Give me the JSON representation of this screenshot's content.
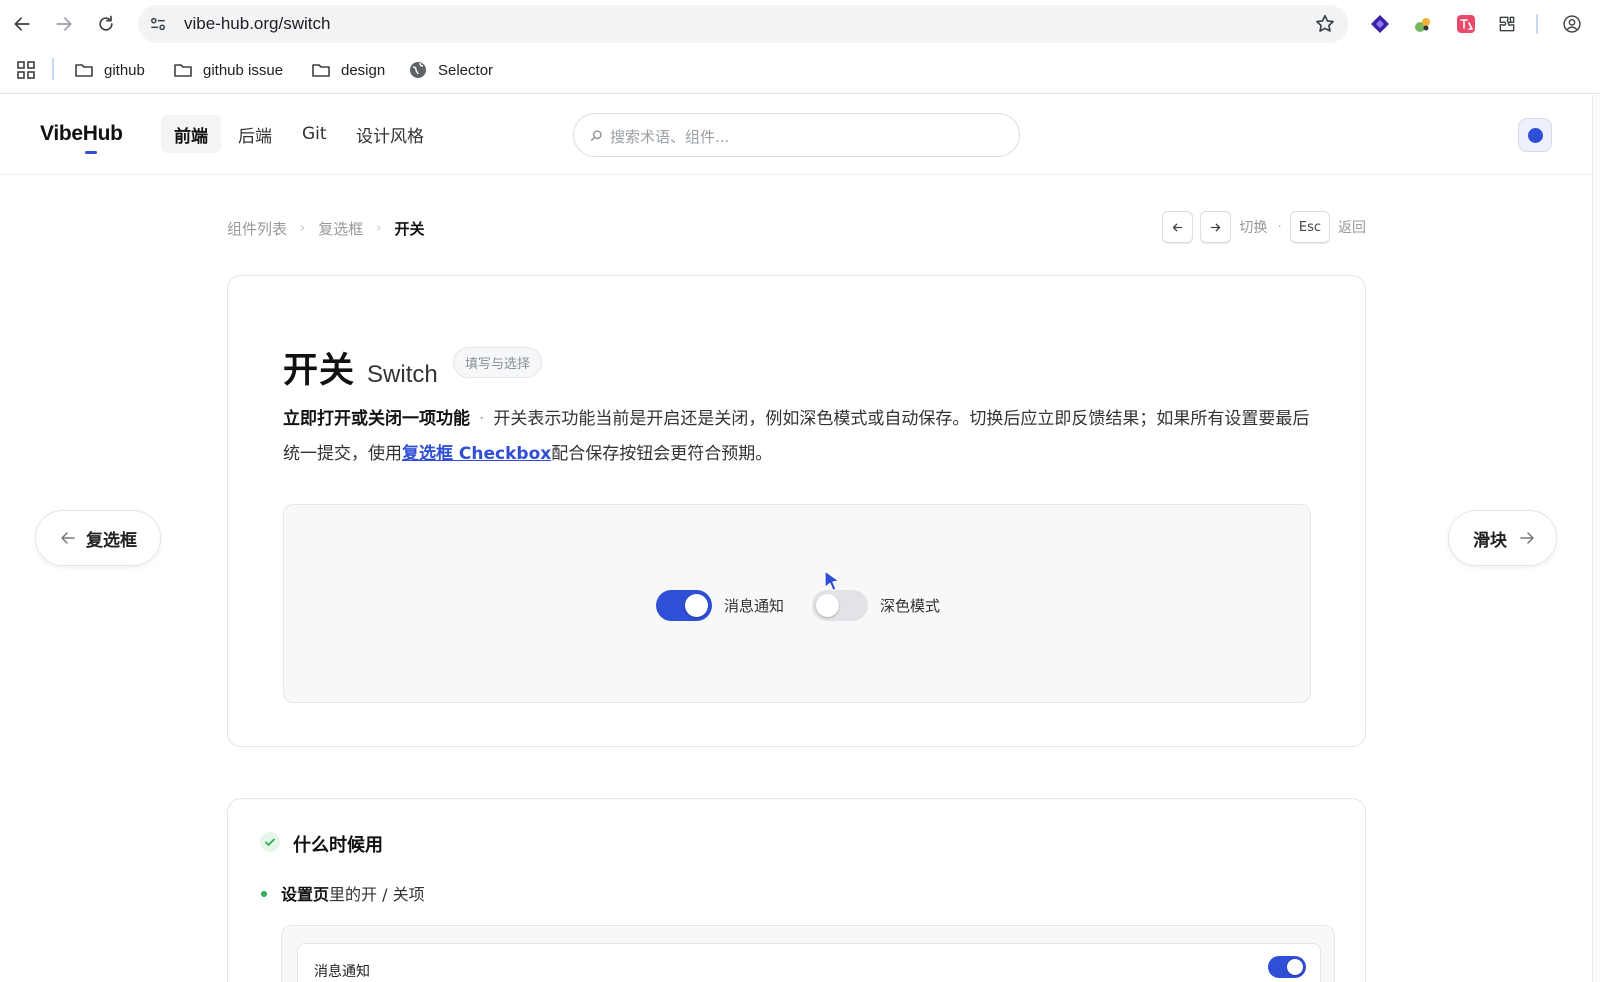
{
  "browser": {
    "url": "vibe-hub.org/switch",
    "bookmarks": [
      "github",
      "github issue",
      "design",
      "Selector"
    ]
  },
  "header": {
    "logo": "VibeHub",
    "tabs": [
      "前端",
      "后端",
      "Git",
      "设计风格"
    ],
    "active_tab": "前端",
    "search_placeholder": "搜索术语、组件...",
    "accent_color": "#2f4fd6"
  },
  "breadcrumb": {
    "items": [
      "组件列表",
      "复选框",
      "开关"
    ],
    "hints": {
      "switch": "切换",
      "esc_key": "Esc",
      "back": "返回"
    }
  },
  "side_nav": {
    "prev": "复选框",
    "next": "滑块"
  },
  "component": {
    "title_zh": "开关",
    "title_en": "Switch",
    "tag": "填写与选择",
    "summary": "立即打开或关闭一项功能",
    "desc_part1": "开关表示功能当前是开启还是关闭，例如深色模式或自动保存。切换后应立即反馈结果；如果所有设置要最后统一提交，使用",
    "link_text": "复选框 Checkbox",
    "desc_part2": "配合保存按钮会更符合预期。"
  },
  "demo": {
    "switches": [
      {
        "label": "消息通知",
        "on": true
      },
      {
        "label": "深色模式",
        "on": false
      }
    ]
  },
  "when_to_use": {
    "title": "什么时候用",
    "bullet_bold": "设置页",
    "bullet_rest": "里的开 / 关项",
    "preview_row_label": "消息通知",
    "preview_row_on": true
  }
}
